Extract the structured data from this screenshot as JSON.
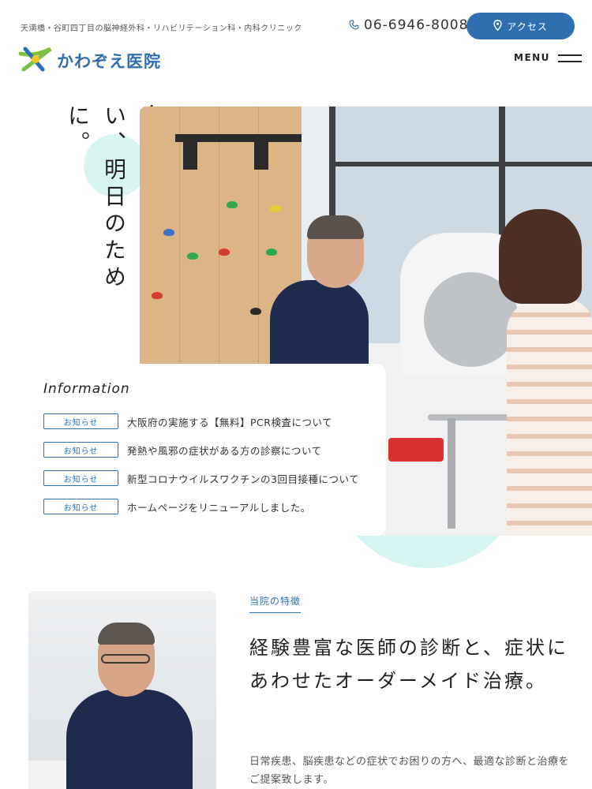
{
  "header": {
    "tagline": "天満橋・谷町四丁目の脳神経外科・リハビリテーション科・内科クリニック",
    "logo_text": "かわぞえ医院",
    "phone": "06-6946-8008",
    "access_label": "アクセス",
    "menu_label": "MENU",
    "icons": {
      "phone": "phone-icon",
      "access": "map-pin-icon",
      "menu": "hamburger-icon",
      "logo": "star-logo-icon"
    }
  },
  "hero": {
    "catchphrase": "今日より明るい、明日のために。"
  },
  "information": {
    "title": "Information",
    "items": [
      {
        "category": "お知らせ",
        "text": "大阪府の実施する【無料】PCR検査について"
      },
      {
        "category": "お知らせ",
        "text": "発熱や風邪の症状がある方の診察について"
      },
      {
        "category": "お知らせ",
        "text": "新型コロナウイルスワクチンの3回目接種について"
      },
      {
        "category": "お知らせ",
        "text": "ホームページをリニューアルしました。"
      }
    ]
  },
  "features": {
    "label": "当院の特徴",
    "heading": "経験豊富な医師の診断と、症状にあわせたオーダーメイド治療。",
    "body": "日常疾患、脳疾患などの症状でお困りの方へ、最適な診断と治療をご提案致します。"
  },
  "colors": {
    "brand": "#2f6fb0",
    "accent": "#d6f4f1",
    "text": "#333333"
  }
}
